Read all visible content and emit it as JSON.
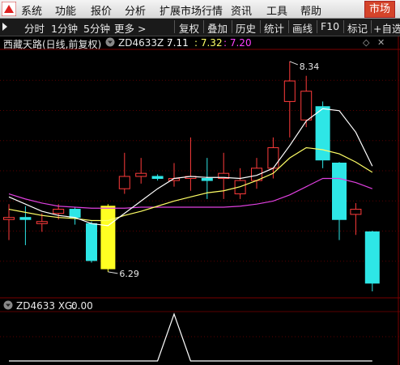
{
  "menu": {
    "items": [
      "系统",
      "功能",
      "报价",
      "分析",
      "扩展市场行情",
      "资讯",
      "工具",
      "帮助"
    ],
    "market_label": "市场"
  },
  "toolbar": {
    "left_items": [
      "分时",
      "1分钟",
      "5分钟",
      "更多 >"
    ],
    "right_items": [
      "复权",
      "叠加",
      "历史",
      "统计",
      "画线",
      "F10",
      "标记",
      "+自选"
    ]
  },
  "main_panel": {
    "title": "西藏天路(日线,前复权)",
    "indicator_label": "ZD4633Z :",
    "values": [
      "7.11",
      ": 7.32",
      ": 7.20"
    ],
    "colors": {
      "v1": "#ffffff",
      "v2": "#ffff66",
      "v3": "#ff40ff"
    },
    "high_label": "8.34",
    "low_label": "6.29",
    "chart_data": {
      "type": "candlestick",
      "candles": [
        {
          "o": 6.8,
          "c": 6.82,
          "h": 6.95,
          "l": 6.6
        },
        {
          "o": 6.82,
          "c": 6.8,
          "h": 6.93,
          "l": 6.55
        },
        {
          "o": 6.76,
          "c": 6.78,
          "h": 6.86,
          "l": 6.68
        },
        {
          "o": 6.86,
          "c": 6.9,
          "h": 6.95,
          "l": 6.8
        },
        {
          "o": 6.9,
          "c": 6.82,
          "h": 6.92,
          "l": 6.75
        },
        {
          "o": 6.76,
          "c": 6.4,
          "h": 6.78,
          "l": 6.38
        },
        {
          "o": 6.32,
          "c": 6.93,
          "h": 6.95,
          "l": 6.29
        },
        {
          "o": 7.1,
          "c": 7.22,
          "h": 7.45,
          "l": 7.05
        },
        {
          "o": 7.22,
          "c": 7.25,
          "h": 7.4,
          "l": 7.15
        },
        {
          "o": 7.22,
          "c": 7.2,
          "h": 7.24,
          "l": 7.18
        },
        {
          "o": 7.18,
          "c": 7.2,
          "h": 7.35,
          "l": 7.12
        },
        {
          "o": 7.2,
          "c": 7.22,
          "h": 7.6,
          "l": 7.08
        },
        {
          "o": 7.2,
          "c": 7.18,
          "h": 7.4,
          "l": 7.0
        },
        {
          "o": 7.2,
          "c": 7.25,
          "h": 7.45,
          "l": 7.0
        },
        {
          "o": 7.05,
          "c": 7.18,
          "h": 7.3,
          "l": 7.0
        },
        {
          "o": 7.18,
          "c": 7.3,
          "h": 7.4,
          "l": 7.1
        },
        {
          "o": 7.3,
          "c": 7.5,
          "h": 7.6,
          "l": 7.2
        },
        {
          "o": 7.95,
          "c": 8.15,
          "h": 8.34,
          "l": 7.6
        },
        {
          "o": 7.77,
          "c": 8.05,
          "h": 8.2,
          "l": 7.7
        },
        {
          "o": 7.9,
          "c": 7.38,
          "h": 7.95,
          "l": 7.3
        },
        {
          "o": 7.35,
          "c": 6.8,
          "h": 7.36,
          "l": 6.6
        },
        {
          "o": 6.85,
          "c": 6.9,
          "h": 6.96,
          "l": 6.65
        },
        {
          "o": 6.68,
          "c": 6.18,
          "h": 6.69,
          "l": 6.1
        }
      ],
      "ma_white": [
        7.02,
        6.95,
        6.88,
        6.84,
        6.82,
        6.76,
        6.74,
        6.86,
        6.98,
        7.1,
        7.2,
        7.22,
        7.21,
        7.21,
        7.2,
        7.23,
        7.3,
        7.52,
        7.76,
        7.88,
        7.86,
        7.65,
        7.32
      ],
      "ma_yellow": [
        6.9,
        6.87,
        6.84,
        6.82,
        6.81,
        6.79,
        6.79,
        6.84,
        6.88,
        6.93,
        6.98,
        7.02,
        7.06,
        7.08,
        7.12,
        7.18,
        7.25,
        7.4,
        7.5,
        7.48,
        7.44,
        7.36,
        7.26
      ],
      "ma_magenta": [
        7.05,
        7.0,
        6.96,
        6.93,
        6.92,
        6.91,
        6.91,
        6.91,
        6.92,
        6.92,
        6.92,
        6.92,
        6.92,
        6.92,
        6.93,
        6.95,
        6.98,
        7.04,
        7.12,
        7.2,
        7.2,
        7.16,
        7.1
      ]
    }
  },
  "sub_panel": {
    "indicator_label": "ZD4633 XG:",
    "value": "0.00",
    "chart_data": {
      "type": "line",
      "values": [
        0,
        0,
        0,
        0,
        0,
        0,
        0,
        0,
        0,
        0,
        1,
        0,
        0,
        0,
        0,
        0,
        0,
        0,
        0,
        0,
        0,
        0,
        0
      ]
    }
  }
}
